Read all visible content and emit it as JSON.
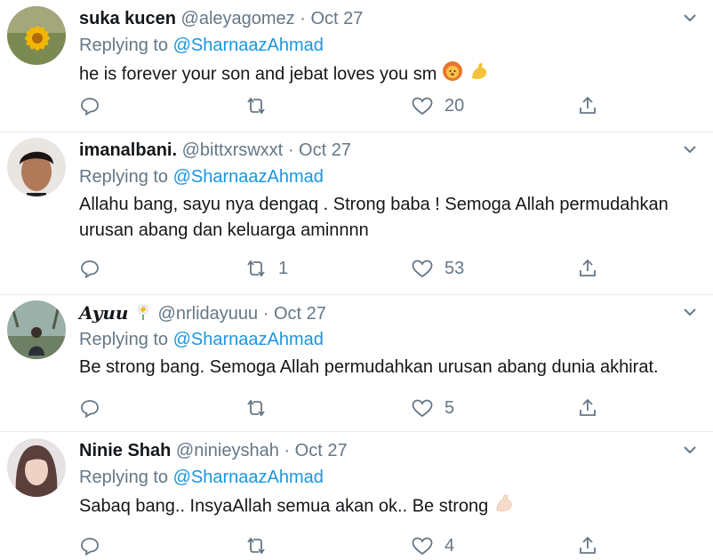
{
  "tweets": [
    {
      "name": "suka kucen",
      "handle": "@aleyagomez",
      "date": "Oct 27",
      "replying_prefix": "Replying to",
      "replying_to": "@SharnaazAhmad",
      "text": "he is forever your son and jebat loves you sm",
      "emojis": [
        "lion-face",
        "flexed-biceps"
      ],
      "replies": "",
      "retweets": "",
      "likes": "20"
    },
    {
      "name": "imanalbani.",
      "handle": "@bittxrswxxt",
      "date": "Oct 27",
      "replying_prefix": "Replying to",
      "replying_to": "@SharnaazAhmad",
      "text_line1": "Allahu bang, sayu nya dengaq . Strong baba ! Semoga Allah permudahkan",
      "text_line2": "urusan abang dan keluarga aminnnn",
      "replies": "",
      "retweets": "1",
      "likes": "53"
    },
    {
      "name": "Ayuu",
      "name_emoji": "daisy",
      "handle": "@nrlidayuuu",
      "date": "Oct 27",
      "replying_prefix": "Replying to",
      "replying_to": "@SharnaazAhmad",
      "text": "Be strong bang. Semoga Allah permudahkan urusan abang dunia akhirat.",
      "replies": "",
      "retweets": "",
      "likes": "5"
    },
    {
      "name": "Ninie Shah",
      "handle": "@ninieyshah",
      "date": "Oct 27",
      "replying_prefix": "Replying to",
      "replying_to": "@SharnaazAhmad",
      "text": "Sabaq bang.. InsyaAllah semua akan ok.. Be strong",
      "emojis": [
        "flexed-biceps-light-skin"
      ],
      "replies": "",
      "retweets": "",
      "likes": "4"
    }
  ],
  "colors": {
    "text": "#14171a",
    "secondary": "#657786",
    "link": "#1b95e0",
    "divider": "#e6ecf0"
  }
}
